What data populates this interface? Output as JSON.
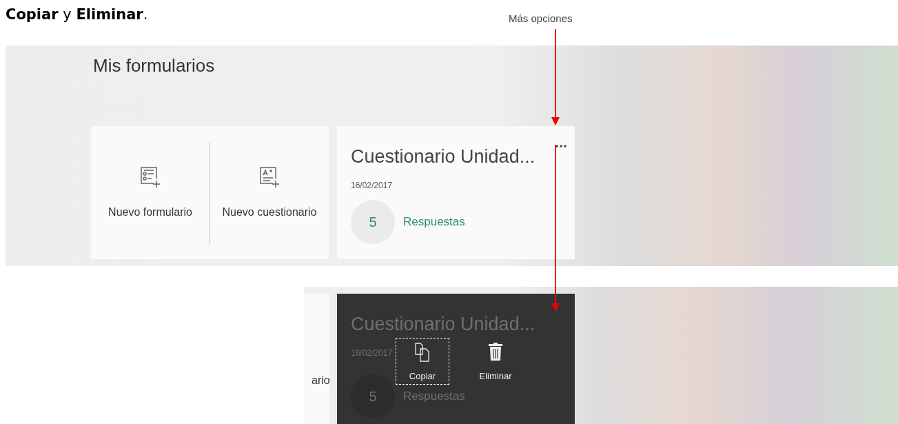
{
  "intro": "**Copiar** y **Eliminar**.",
  "callout": {
    "label": "Más opciones"
  },
  "screenshot_1": {
    "heading": "Mis formularios",
    "new_items": [
      {
        "label": "Nuevo formulario",
        "kind": "form"
      },
      {
        "label": "Nuevo cuestionario",
        "kind": "quiz"
      }
    ],
    "form_card": {
      "title": "Cuestionario Unidad...",
      "date": "16/02/2017",
      "response_count": "5",
      "responses_label": "Respuestas"
    }
  },
  "screenshot_2": {
    "partial_label": "ario",
    "form_card": {
      "title": "Cuestionario Unidad...",
      "date": "16/02/2017",
      "response_count": "5",
      "responses_label": "Respuestas"
    },
    "menu": [
      {
        "label": "Copiar",
        "kind": "copy",
        "selected": true
      },
      {
        "label": "Eliminar",
        "kind": "delete",
        "selected": false
      }
    ]
  }
}
